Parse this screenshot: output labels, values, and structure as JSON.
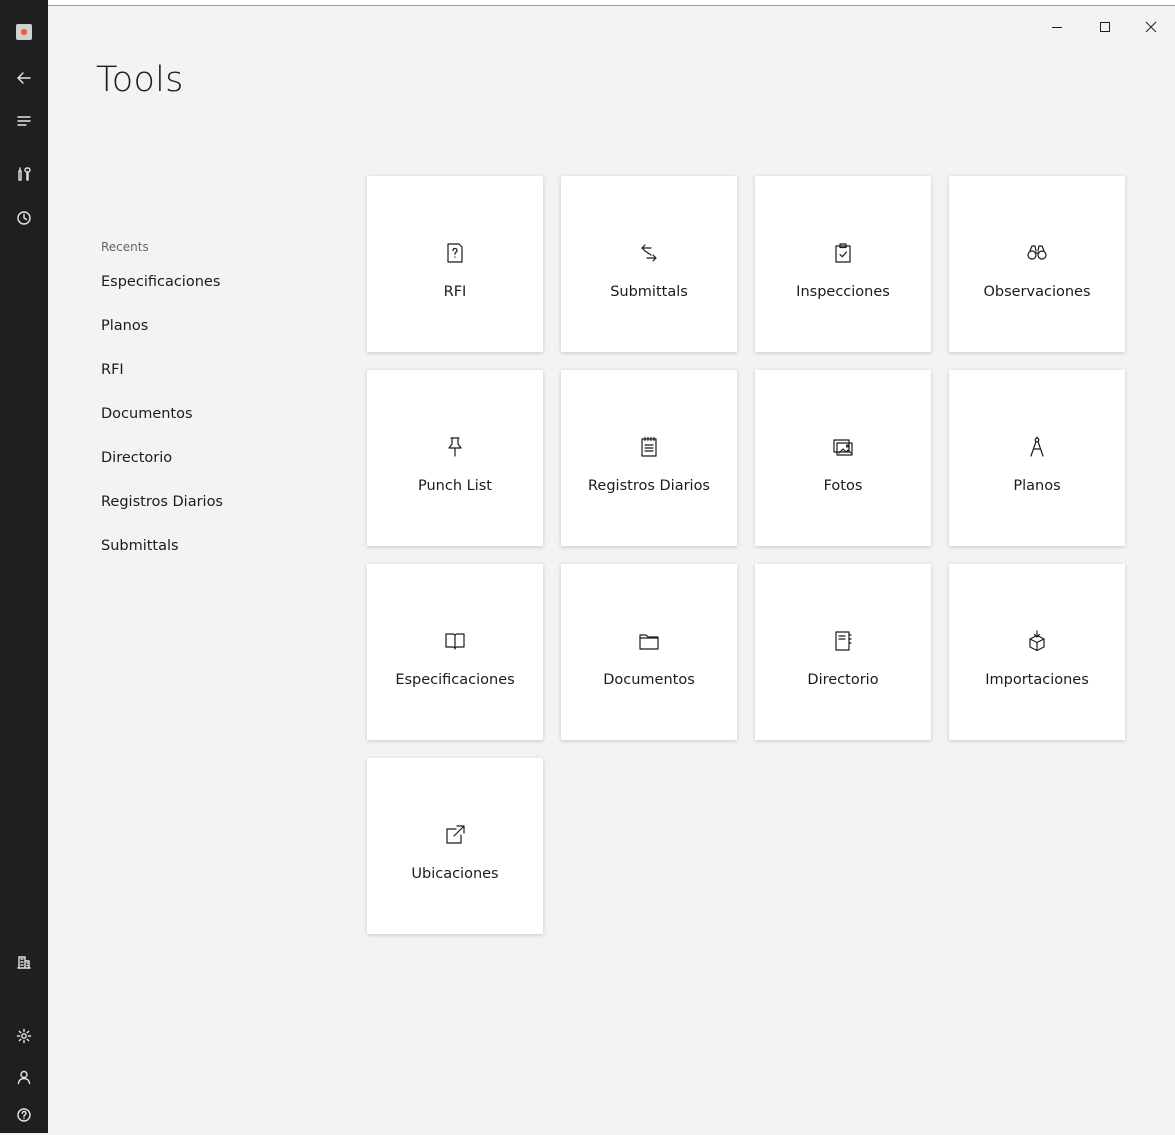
{
  "window": {
    "controls": [
      "minimize-icon",
      "maximize-icon",
      "close-icon"
    ]
  },
  "rail": {
    "top_icons": [
      "app-logo-icon",
      "back-arrow-icon",
      "menu-icon",
      "tools-icon",
      "recent-clock-icon"
    ],
    "bottom_icons": [
      "building-icon",
      "settings-gear-icon",
      "user-icon",
      "help-icon"
    ],
    "accent_color": "#e8562a",
    "background": "#1f1f1f"
  },
  "page": {
    "title": "Tools"
  },
  "recents": {
    "heading": "Recents",
    "items": [
      "Especificaciones",
      "Planos",
      "RFI",
      "Documentos",
      "Directorio",
      "Registros Diarios",
      "Submittals"
    ]
  },
  "tools": [
    {
      "label": "RFI",
      "icon": "rfi-question-document-icon"
    },
    {
      "label": "Submittals",
      "icon": "submittals-exchange-icon"
    },
    {
      "label": "Inspecciones",
      "icon": "clipboard-check-icon"
    },
    {
      "label": "Observaciones",
      "icon": "binoculars-icon"
    },
    {
      "label": "Punch List",
      "icon": "pushpin-icon"
    },
    {
      "label": "Registros Diarios",
      "icon": "notepad-icon"
    },
    {
      "label": "Fotos",
      "icon": "photos-icon"
    },
    {
      "label": "Planos",
      "icon": "drafting-compass-icon"
    },
    {
      "label": "Especificaciones",
      "icon": "open-book-icon"
    },
    {
      "label": "Documentos",
      "icon": "folder-icon"
    },
    {
      "label": "Directorio",
      "icon": "address-book-icon"
    },
    {
      "label": "Importaciones",
      "icon": "import-box-icon"
    },
    {
      "label": "Ubicaciones",
      "icon": "external-link-icon"
    }
  ]
}
